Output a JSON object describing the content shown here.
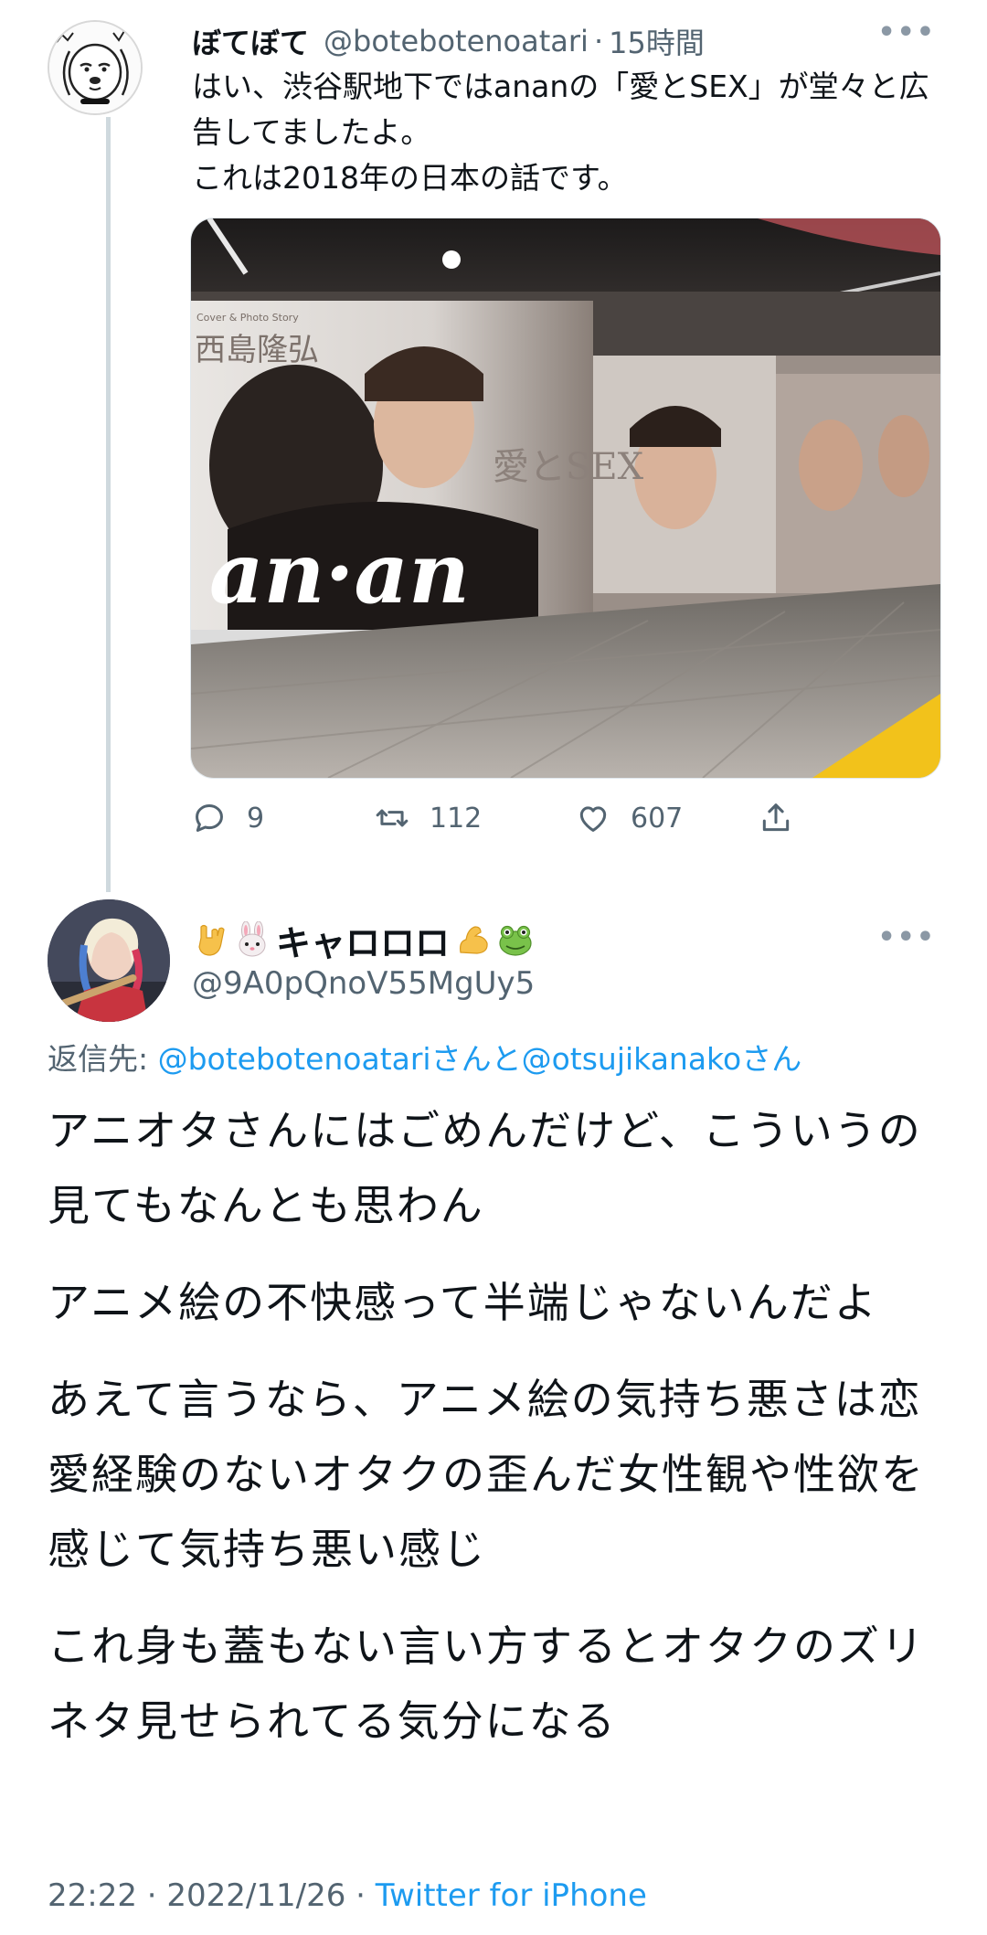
{
  "parent_tweet": {
    "author_name": "ぼてぼて",
    "handle": "@botebotenoatari",
    "separator": "·",
    "time": "15時間",
    "more_icon": "more-horizontal-icon",
    "text_lines": [
      "はい、渋谷駅地下ではananの「愛とSEX」が堂々と広告してましたよ。",
      "これは2018年の日本の話です。"
    ],
    "photo": {
      "poster_text_credit": "Cover & Photo Story",
      "poster_text_name": "西島隆弘",
      "poster_text_title": "愛とSEX",
      "poster_text_logo": "an·an"
    },
    "actions": {
      "reply_count": "9",
      "retweet_count": "112",
      "like_count": "607"
    }
  },
  "reply_tweet": {
    "author_name": "キャロロロ",
    "emoji_before": [
      "🤟",
      "🐰"
    ],
    "emoji_after": [
      "💪",
      "🐸"
    ],
    "handle": "@9A0pQnoV55MgUy5",
    "more_icon": "more-horizontal-icon",
    "replying_to": {
      "prefix": "返信先: ",
      "user1": "@botebotenoatari",
      "joiner": "さんと",
      "user2": "@otsujikanako",
      "suffix": "さん"
    },
    "paragraphs": [
      "アニオタさんにはごめんだけど、こういうの見てもなんとも思わん",
      "アニメ絵の不快感って半端じゃないんだよ",
      "あえて言うなら、アニメ絵の気持ち悪さは恋愛経験のないオタクの歪んだ女性観や性欲を感じて気持ち悪い感じ",
      "これ身も蓋もない言い方するとオタクのズリネタ見せられてる気分になる"
    ],
    "timestamp": "22:22 · 2022/11/26 · ",
    "source": "Twitter for iPhone"
  },
  "colors": {
    "text": "#0f1419",
    "secondary": "#536471",
    "link": "#1d9bf0",
    "thread_line": "#cfd9de"
  }
}
